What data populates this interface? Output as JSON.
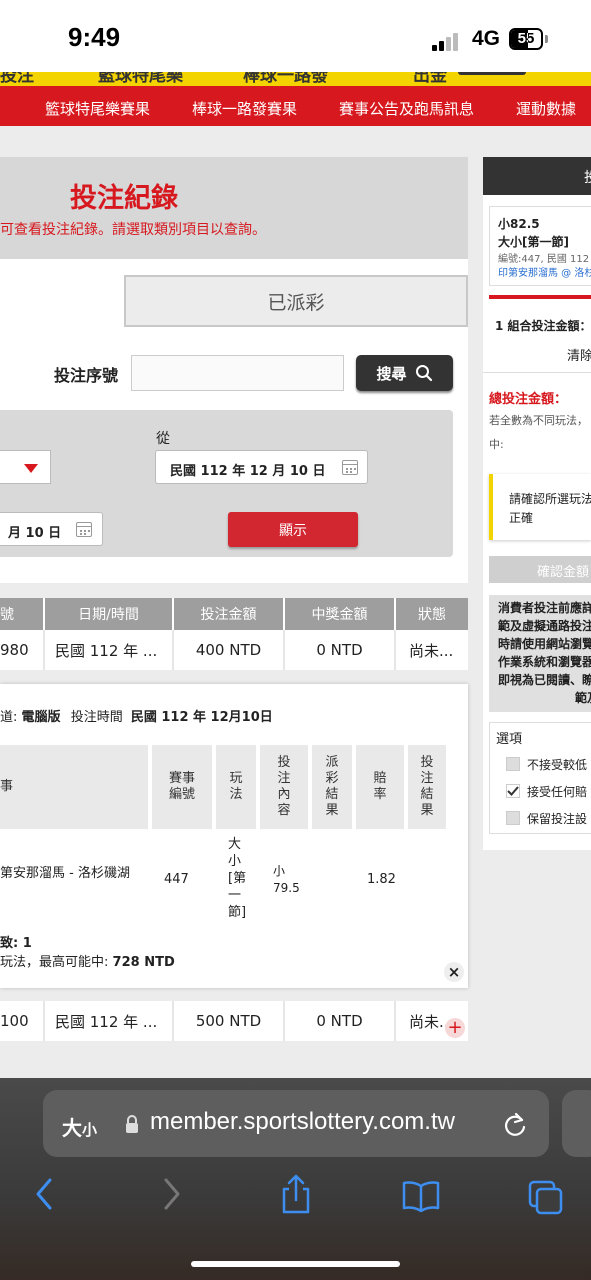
{
  "status_bar": {
    "time": "9:49",
    "network": "4G",
    "battery": "55"
  },
  "nav": {
    "ghost_items": [
      "投注",
      "籃球特尾樂",
      "棒球一路發",
      "出金"
    ],
    "items": [
      "籃球特尾樂賽果",
      "棒球一路發賽果",
      "賽事公告及跑馬訊息",
      "運動數據"
    ]
  },
  "page": {
    "title": "投注紀錄",
    "subtitle": "可查看投注紀錄。請選取類別項目以查詢。",
    "tab_paid": "已派彩",
    "serial_label": "投注序號",
    "search_label": "搜尋",
    "from_label": "從",
    "date_from": "民國 112 年 12 月 10 日",
    "date_to": "月 10 日",
    "show_label": "顯示"
  },
  "table": {
    "headers": [
      "號",
      "日期/時間",
      "投注金額",
      "中獎金額",
      "狀態"
    ],
    "rows": [
      [
        "980",
        "民國 112 年 ...",
        "400 NTD",
        "0 NTD",
        "尚未..."
      ],
      [
        "100",
        "民國 112 年 ...",
        "500 NTD",
        "0 NTD",
        "尚未..."
      ]
    ]
  },
  "detail": {
    "channel_label": "道:",
    "channel_value": "電腦版",
    "time_label": "投注時間",
    "time_value": "民國 112 年 12月10日",
    "headers": [
      "事",
      "賽事\n編號",
      "玩\n法",
      "投\n注\n內\n容",
      "派\n彩\n結\n果",
      "賠\n率",
      "投\n注\n結\n果"
    ],
    "event": "第安那溜馬 - 洛杉磯湖",
    "event_no": "447",
    "play": "大\n小\n[第\n一\n節]",
    "content": "小\n79.5",
    "odds": "1.82",
    "count_label": "致: 1",
    "max_win_label": "玩法，最高可能中:",
    "max_win_value": "728 NTD"
  },
  "right_panel": {
    "header": "投",
    "slip_pick": "小82.5",
    "slip_market": "大小[第一節]",
    "slip_meta": "編號:447, 民國 112",
    "slip_teams": "印第安那溜馬 @ 洛杉",
    "combo_label": "1 組合投注金額：",
    "clear_label": "清除",
    "total_label": "總投注金額：",
    "note_line1": "若全數為不同玩法，",
    "note_line2": "中:",
    "confirm_msg_1": "請確認所選玩法",
    "confirm_msg_2": "正確",
    "confirm_btn": "確認金額",
    "notice_lines": [
      "消費者投注前應詳",
      "範及虛擬通路投注",
      "時請使用網站瀏覽",
      "作業系統和瀏覽器",
      "即視為已閱讀、瞭",
      "範及"
    ],
    "options_title": "選項",
    "options": [
      "不接受較低",
      "接受任何賠",
      "保留投注設"
    ]
  },
  "browser": {
    "aa_label": "大",
    "aa_small": "小",
    "url": "member.sportslottery.com.tw"
  },
  "colors": {
    "brand_red": "#d7191f",
    "brand_yellow": "#f3d300",
    "dark_button": "#333333"
  }
}
